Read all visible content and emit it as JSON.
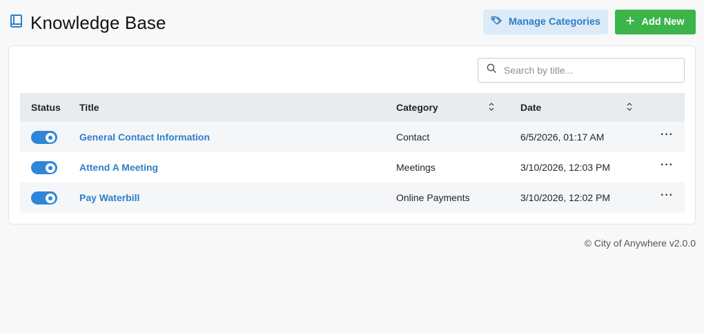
{
  "header": {
    "title": "Knowledge Base",
    "manage_label": "Manage Categories",
    "add_label": "Add New"
  },
  "search": {
    "placeholder": "Search by title...",
    "value": ""
  },
  "table": {
    "columns": {
      "status": "Status",
      "title": "Title",
      "category": "Category",
      "date": "Date"
    },
    "rows": [
      {
        "enabled": true,
        "title": "General Contact Information",
        "category": "Contact",
        "date": "6/5/2026, 01:17 AM"
      },
      {
        "enabled": true,
        "title": "Attend A Meeting",
        "category": "Meetings",
        "date": "3/10/2026, 12:03 PM"
      },
      {
        "enabled": true,
        "title": "Pay Waterbill",
        "category": "Online Payments",
        "date": "3/10/2026, 12:02 PM"
      }
    ],
    "more_glyph": "···"
  },
  "footer": {
    "text": "© City of Anywhere v2.0.0"
  },
  "colors": {
    "accent": "#2d7fc7",
    "success": "#3bb54a",
    "toggle": "#2f86d9"
  },
  "icons": {
    "title": "book-icon",
    "manage": "tag-icon",
    "add": "plus-icon",
    "search": "search-icon",
    "sort": "sort-icon",
    "more": "more-icon"
  }
}
